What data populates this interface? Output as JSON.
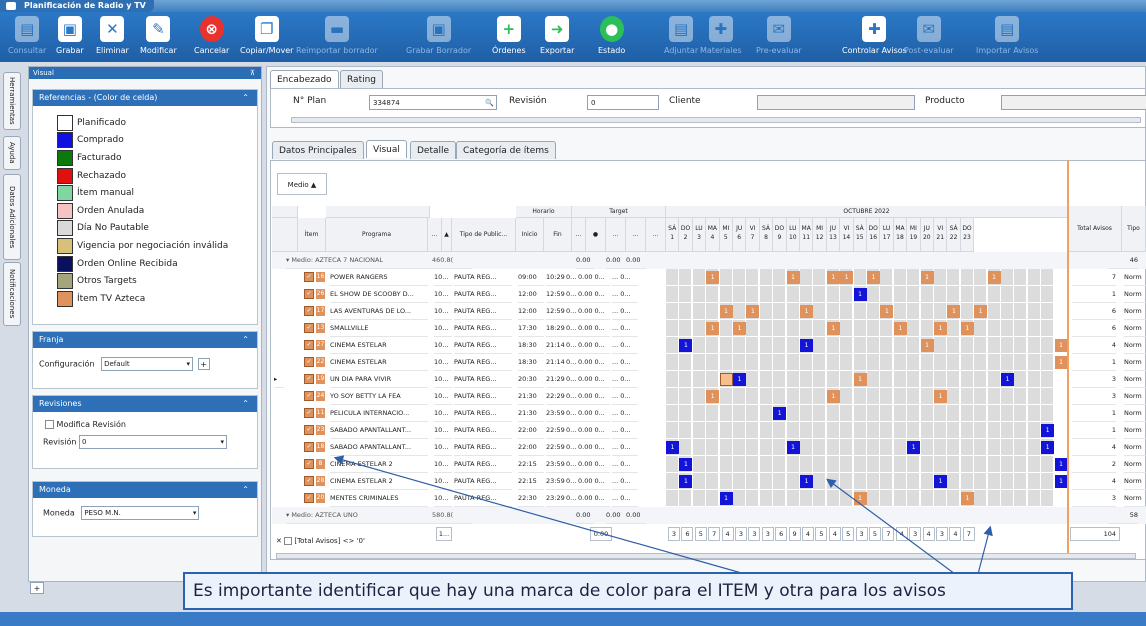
{
  "window": {
    "title": "Planificación de Radio y TV"
  },
  "ribbon": [
    {
      "label": "Consultar",
      "icon": "doc-check-icon",
      "enabled": false
    },
    {
      "label": "Grabar",
      "icon": "save-icon",
      "enabled": true
    },
    {
      "label": "Eliminar",
      "icon": "delete-doc-icon",
      "enabled": true
    },
    {
      "label": "Modificar",
      "icon": "edit-icon",
      "enabled": true
    },
    {
      "label": "Cancelar",
      "icon": "cancel-icon",
      "enabled": true
    },
    {
      "label": "Copiar/Mover",
      "icon": "copy-icon",
      "enabled": true
    },
    {
      "label": "Reimportar borrador",
      "icon": "folder-icon",
      "enabled": false
    },
    {
      "label": "Grabar Borrador",
      "icon": "save-draft-icon",
      "enabled": false
    },
    {
      "label": "Órdenes",
      "icon": "orders-icon",
      "enabled": true
    },
    {
      "label": "Exportar",
      "icon": "export-icon",
      "enabled": true
    },
    {
      "label": "Estado",
      "icon": "status-icon",
      "enabled": true
    },
    {
      "label": "Adjuntar",
      "icon": "attach-icon",
      "enabled": false
    },
    {
      "label": "Materiales",
      "icon": "tools-icon",
      "enabled": false
    },
    {
      "label": "Pre-evaluar",
      "icon": "mail-icon",
      "enabled": false
    },
    {
      "label": "Controlar Avisos",
      "icon": "wrench-icon",
      "enabled": true
    },
    {
      "label": "Post-evaluar",
      "icon": "mail-icon",
      "enabled": false
    },
    {
      "label": "Importar Avisos",
      "icon": "import-icon",
      "enabled": false
    }
  ],
  "sidetabs": [
    "Herramientas",
    "Ayuda",
    "Datos Adicionales",
    "Notificaciones"
  ],
  "left_panel": {
    "title": "Visual",
    "references_title": "Referencias - (Color de celda)",
    "legend": [
      {
        "label": "Planificado",
        "color": "#ffffff"
      },
      {
        "label": "Comprado",
        "color": "#1010e0"
      },
      {
        "label": "Facturado",
        "color": "#0a7a0a"
      },
      {
        "label": "Rechazado",
        "color": "#e01010"
      },
      {
        "label": "Ítem manual",
        "color": "#7fd6a0"
      },
      {
        "label": "Orden Anulada",
        "color": "#f6c3c3"
      },
      {
        "label": "Día No Pautable",
        "color": "#d9d9d9"
      },
      {
        "label": "Vigencia por negociación inválida",
        "color": "#d7c07a"
      },
      {
        "label": "Orden Online Recibida",
        "color": "#0a1060"
      },
      {
        "label": "Otros Targets",
        "color": "#a6a47a"
      },
      {
        "label": "Ítem TV Azteca",
        "color": "#e0925c"
      }
    ],
    "franja": {
      "title": "Franja",
      "config_label": "Configuración",
      "config_value": "Default",
      "add": "+"
    },
    "revisiones": {
      "title": "Revisiones",
      "checkbox_label": "Modifica Revisión",
      "rev_label": "Revisión",
      "rev_value": "0"
    },
    "moneda": {
      "title": "Moneda",
      "label": "Moneda",
      "value": "PESO M.N."
    }
  },
  "main": {
    "top_tabs": [
      "Encabezado",
      "Rating"
    ],
    "header": {
      "plan_label": "N° Plan",
      "plan_value": "334874",
      "revision_label": "Revisión",
      "revision_value": "0",
      "cliente_label": "Cliente",
      "producto_label": "Producto"
    },
    "sub_tabs": [
      "Datos Principales",
      "Visual",
      "Detalle",
      "Categoría de ítems"
    ],
    "group_btn": "Medio ▲",
    "columns": {
      "item": "Ítem",
      "programa": "Programa",
      "dot": "...",
      "sort": "▲",
      "tipo": "Tipo de Public...",
      "horario": "Horario",
      "inicio": "Inicio",
      "fin": "Fin",
      "target": "Target",
      "month": "OCTUBRE 2022",
      "total": "Total Avisos",
      "tipo2": "Tipo"
    },
    "days": [
      {
        "d": "SÁ",
        "n": "1"
      },
      {
        "d": "DO",
        "n": "2"
      },
      {
        "d": "LU",
        "n": "3"
      },
      {
        "d": "MA",
        "n": "4"
      },
      {
        "d": "MI",
        "n": "5"
      },
      {
        "d": "JU",
        "n": "6"
      },
      {
        "d": "VI",
        "n": "7"
      },
      {
        "d": "SÁ",
        "n": "8"
      },
      {
        "d": "DO",
        "n": "9"
      },
      {
        "d": "LU",
        "n": "10"
      },
      {
        "d": "MA",
        "n": "11"
      },
      {
        "d": "MI",
        "n": "12"
      },
      {
        "d": "JU",
        "n": "13"
      },
      {
        "d": "VI",
        "n": "14"
      },
      {
        "d": "SÁ",
        "n": "15"
      },
      {
        "d": "DO",
        "n": "16"
      },
      {
        "d": "LU",
        "n": "17"
      },
      {
        "d": "MA",
        "n": "18"
      },
      {
        "d": "MI",
        "n": "19"
      },
      {
        "d": "JU",
        "n": "20"
      },
      {
        "d": "VI",
        "n": "21"
      },
      {
        "d": "SÁ",
        "n": "22"
      },
      {
        "d": "DO",
        "n": "23"
      }
    ],
    "group1": {
      "label": "Medio: AZTECA 7 NACIONAL",
      "v1": "460.8(",
      "v2": "0.00",
      "v3": "0.00",
      "v4": "0.00",
      "total": "46"
    },
    "rows": [
      {
        "item": "16",
        "prog": "POWER RANGERS",
        "a": "10...",
        "tipo": "PAUTA REG...",
        "ini": "09:00",
        "fin": "10:29",
        "t": "0...",
        "tv": "0.00 0...",
        "tz": "... 0...",
        "total": "7",
        "tipo2": "Norm",
        "marks": [
          [
            3,
            "o"
          ],
          [
            9,
            "o"
          ],
          [
            12,
            "o"
          ],
          [
            13,
            "o"
          ],
          [
            15,
            "o"
          ],
          [
            19,
            "o"
          ],
          [
            24,
            "o"
          ]
        ]
      },
      {
        "item": "26",
        "prog": "EL SHOW DE SCOOBY D...",
        "a": "10...",
        "tipo": "PAUTA REG...",
        "ini": "12:00",
        "fin": "12:59",
        "t": "0...",
        "tv": "0.00 0...",
        "tz": "... 0...",
        "total": "1",
        "tipo2": "Norm",
        "marks": [
          [
            14,
            "b"
          ]
        ]
      },
      {
        "item": "17",
        "prog": "LAS AVENTURAS DE LO...",
        "a": "10...",
        "tipo": "PAUTA REG...",
        "ini": "12:00",
        "fin": "12:59",
        "t": "0...",
        "tv": "0.00 0...",
        "tz": "... 0...",
        "total": "6",
        "tipo2": "Norm",
        "marks": [
          [
            4,
            "o"
          ],
          [
            6,
            "o"
          ],
          [
            10,
            "o"
          ],
          [
            16,
            "o"
          ],
          [
            21,
            "o"
          ],
          [
            23,
            "o"
          ]
        ]
      },
      {
        "item": "13",
        "prog": "SMALLVILLE",
        "a": "10...",
        "tipo": "PAUTA REG...",
        "ini": "17:30",
        "fin": "18:29",
        "t": "0...",
        "tv": "0.00 0...",
        "tz": "... 0...",
        "total": "6",
        "tipo2": "Norm",
        "marks": [
          [
            3,
            "o"
          ],
          [
            5,
            "o"
          ],
          [
            12,
            "o"
          ],
          [
            17,
            "o"
          ],
          [
            20,
            "o"
          ],
          [
            22,
            "o"
          ]
        ]
      },
      {
        "item": "27",
        "prog": "CINEMA ESTELAR",
        "a": "10...",
        "tipo": "PAUTA REG...",
        "ini": "18:30",
        "fin": "21:14",
        "t": "0...",
        "tv": "0.00 0...",
        "tz": "... 0...",
        "total": "4",
        "tipo2": "Norm",
        "marks": [
          [
            1,
            "b"
          ],
          [
            10,
            "b"
          ],
          [
            19,
            "o"
          ],
          [
            29,
            "o"
          ]
        ]
      },
      {
        "item": "22",
        "prog": "CINEMA ESTELAR",
        "a": "10...",
        "tipo": "PAUTA REG...",
        "ini": "18:30",
        "fin": "21:14",
        "t": "0...",
        "tv": "0.00 0...",
        "tz": "... 0...",
        "total": "1",
        "tipo2": "Norm",
        "marks": [
          [
            29,
            "o"
          ]
        ]
      },
      {
        "item": "19",
        "prog": "UN DIA PARA VIVIR",
        "a": "10...",
        "tipo": "PAUTA REG...",
        "ini": "20:30",
        "fin": "21:29",
        "t": "0...",
        "tv": "0.00 0...",
        "tz": "... 0...",
        "total": "3",
        "tipo2": "Norm",
        "marks": [
          [
            4,
            "s"
          ],
          [
            5,
            "b"
          ],
          [
            14,
            "o"
          ],
          [
            25,
            "b"
          ]
        ]
      },
      {
        "item": "24",
        "prog": "YO SOY  BETTY LA FEA",
        "a": "10...",
        "tipo": "PAUTA REG...",
        "ini": "21:30",
        "fin": "22:29",
        "t": "0...",
        "tv": "0.00 0...",
        "tz": "... 0...",
        "total": "3",
        "tipo2": "Norm",
        "marks": [
          [
            3,
            "o"
          ],
          [
            12,
            "o"
          ],
          [
            20,
            "o"
          ]
        ]
      },
      {
        "item": "11",
        "prog": "PELICULA INTERNACIO...",
        "a": "10...",
        "tipo": "PAUTA REG...",
        "ini": "21:30",
        "fin": "23:59",
        "t": "0...",
        "tv": "0.00 0...",
        "tz": "... 0...",
        "total": "1",
        "tipo2": "Norm",
        "marks": [
          [
            8,
            "b"
          ]
        ]
      },
      {
        "item": "23",
        "prog": "SABADO APANTALLANT...",
        "a": "10...",
        "tipo": "PAUTA REG...",
        "ini": "22:00",
        "fin": "22:59",
        "t": "0...",
        "tv": "0.00 0...",
        "tz": "... 0...",
        "total": "1",
        "tipo2": "Norm",
        "marks": [
          [
            28,
            "b"
          ]
        ]
      },
      {
        "item": "18",
        "prog": "SABADO APANTALLANT...",
        "a": "10...",
        "tipo": "PAUTA REG...",
        "ini": "22:00",
        "fin": "22:59",
        "t": "0...",
        "tv": "0.00 0...",
        "tz": "... 0...",
        "total": "4",
        "tipo2": "Norm",
        "marks": [
          [
            0,
            "b"
          ],
          [
            9,
            "b"
          ],
          [
            18,
            "b"
          ],
          [
            28,
            "b"
          ]
        ]
      },
      {
        "item": "8",
        "prog": "CINEMA ESTELAR 2",
        "a": "10...",
        "tipo": "PAUTA REG...",
        "ini": "22:15",
        "fin": "23:59",
        "t": "0...",
        "tv": "0.00 0...",
        "tz": "... 0...",
        "total": "2",
        "tipo2": "Norm",
        "marks": [
          [
            1,
            "b"
          ],
          [
            29,
            "b"
          ]
        ]
      },
      {
        "item": "28",
        "prog": "CINEMA ESTELAR 2",
        "a": "10...",
        "tipo": "PAUTA REG...",
        "ini": "22:15",
        "fin": "23:59",
        "t": "0...",
        "tv": "0.00 0...",
        "tz": "... 0...",
        "total": "4",
        "tipo2": "Norm",
        "marks": [
          [
            1,
            "b"
          ],
          [
            10,
            "b"
          ],
          [
            20,
            "b"
          ],
          [
            29,
            "b"
          ]
        ]
      },
      {
        "item": "20",
        "prog": "MENTES CRIMINALES",
        "a": "10...",
        "tipo": "PAUTA REG...",
        "ini": "22:30",
        "fin": "23:29",
        "t": "0...",
        "tv": "0.00 0...",
        "tz": "... 0...",
        "total": "3",
        "tipo2": "Norm",
        "marks": [
          [
            4,
            "b"
          ],
          [
            14,
            "o"
          ],
          [
            22,
            "o"
          ]
        ]
      }
    ],
    "group2": {
      "label": "Medio: AZTECA UNO",
      "v1": "580.8(",
      "v2": "0.00",
      "v3": "0.00",
      "v4": "0.00",
      "total": "58"
    },
    "footer": {
      "item_sum": "1...",
      "target_sum": "0.00",
      "day_totals": [
        "3",
        "6",
        "5",
        "7",
        "4",
        "3",
        "3",
        "3",
        "6",
        "9",
        "4",
        "5",
        "4",
        "5",
        "3",
        "5",
        "7",
        "4",
        "3",
        "4",
        "3",
        "4",
        "7"
      ],
      "total": "104"
    },
    "filter": {
      "close": "✕",
      "text": "[Total Avisos] <> '0'"
    }
  },
  "callout": {
    "text": "Es importante identificar que hay una marca de color para el ITEM y otra para los avisos"
  },
  "bottom": {
    "add": "+"
  }
}
